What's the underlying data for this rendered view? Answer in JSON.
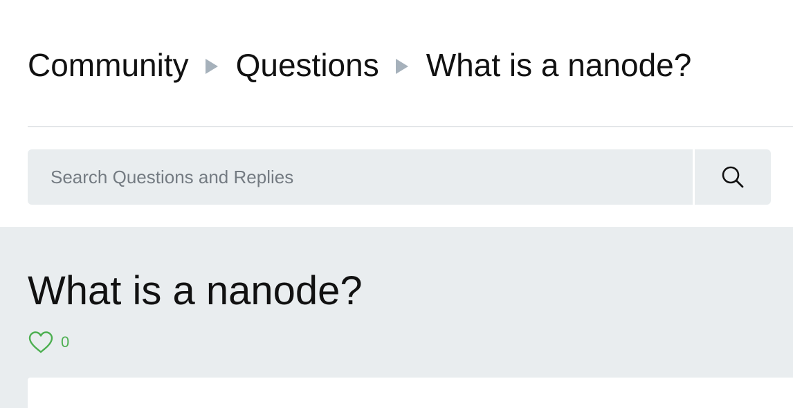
{
  "breadcrumb": {
    "items": [
      {
        "label": "Community"
      },
      {
        "label": "Questions"
      },
      {
        "label": "What is a nanode?"
      }
    ]
  },
  "search": {
    "placeholder": "Search Questions and Replies",
    "value": "",
    "button_icon": "search-icon"
  },
  "question": {
    "title": "What is a nanode?",
    "like_icon": "heart-outline-icon",
    "like_count": "0"
  },
  "colors": {
    "accent_green": "#4caf50",
    "panel_gray": "#e9edef",
    "separator_gray": "#a6b1bb"
  }
}
